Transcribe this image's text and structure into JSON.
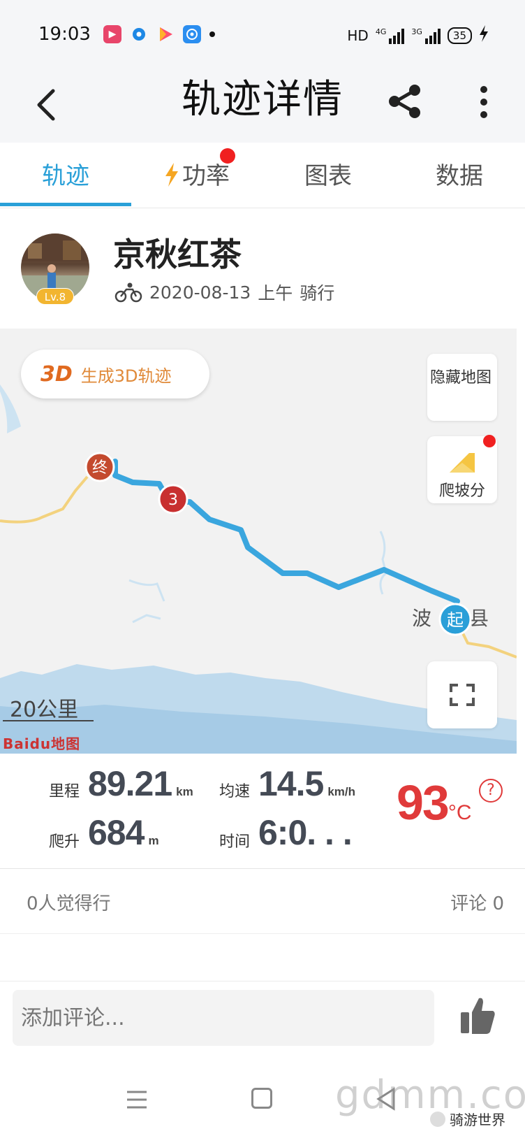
{
  "status_bar": {
    "time": "19:03",
    "network_label": "HD",
    "signal1_label": "4G",
    "signal2_label": "3G",
    "battery": "35"
  },
  "header": {
    "title": "轨迹详情"
  },
  "tabs": [
    {
      "label": "轨迹",
      "active": true
    },
    {
      "label": "功率",
      "active": false,
      "has_dot": true
    },
    {
      "label": "图表",
      "active": false
    },
    {
      "label": "数据",
      "active": false
    }
  ],
  "profile": {
    "username": "京秋红茶",
    "level": "Lv.8",
    "date": "2020-08-13",
    "period": "上午",
    "activity": "骑行"
  },
  "map": {
    "btn_3d_icon_text": "3D",
    "btn_3d_label": "生成3D轨迹",
    "hide_map_label": "隐藏地图",
    "climb_label": "爬坡分",
    "scale_label": "20公里",
    "baidu_logo": "Baidu地图",
    "start_marker": "起",
    "end_marker": "终",
    "checkpoint_marker": "3",
    "place_label": "波",
    "place_label_suffix": "县"
  },
  "stats": {
    "distance_label": "里程",
    "distance_value": "89.21",
    "distance_unit": "km",
    "speed_label": "均速",
    "speed_value": "14.5",
    "speed_unit": "km/h",
    "climb_label": "爬升",
    "climb_value": "684",
    "climb_unit": "m",
    "time_label": "时间",
    "time_value": "6:0. . .",
    "temperature_value": "93",
    "temperature_unit": "°C",
    "help_symbol": "?"
  },
  "social": {
    "likes_text": "0人觉得行",
    "comments_text": "评论 0"
  },
  "comment_bar": {
    "placeholder": "添加评论..."
  },
  "watermark": {
    "text": "gdmm.com",
    "brand": "骑游世界"
  },
  "colors": {
    "accent": "#2aa0d8",
    "track": "#3aa6de",
    "temperature": "#e03a3a",
    "badge_red": "#f02020"
  }
}
